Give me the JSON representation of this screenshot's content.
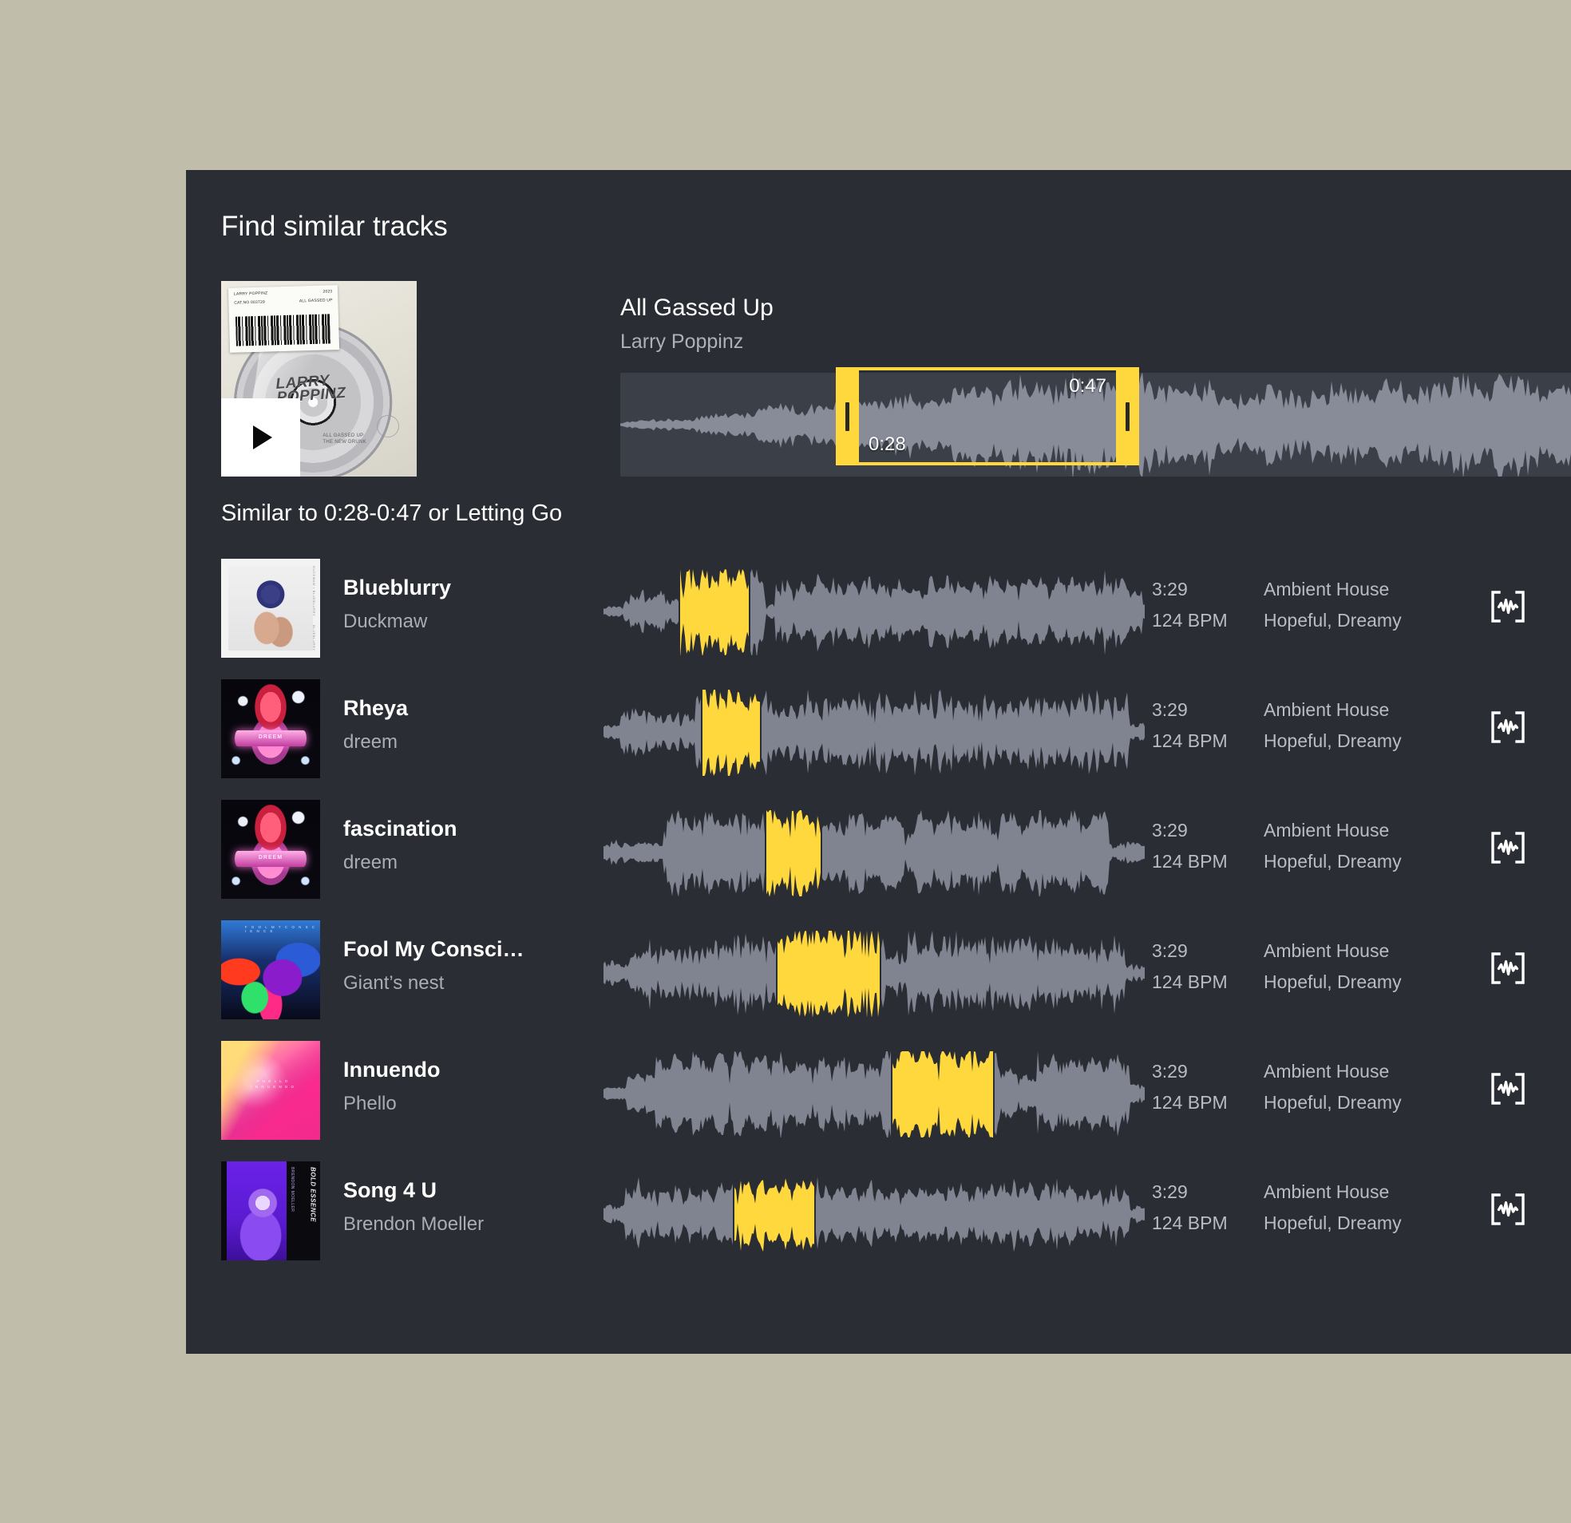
{
  "theme": {
    "page_background": "#c0bdaa",
    "panel_background": "#2a2d33",
    "accent_yellow": "#ffd83d",
    "waveform_gray": "#8e92a0",
    "text_primary": "#ffffff",
    "text_secondary": "#aeb1b8"
  },
  "panel": {
    "title": "Find similar tracks"
  },
  "hero": {
    "title": "All Gassed Up",
    "artist": "Larry Poppinz",
    "play_label": "▶",
    "add_label": "+",
    "artwork": {
      "brand_line1": "LARRY",
      "brand_line2": "POPPINZ",
      "sticker_line1": "LARRY POPPINZ",
      "sticker_line2": "CAT.NO 003729",
      "sticker_line3": "2023",
      "sticker_line4": "ALL GASSED UP",
      "disc_text_line1": "ALL GASSED UP",
      "disc_text_line2": "THE NEW DRUNK"
    },
    "selection": {
      "start_time": "0:28",
      "end_time": "0:47"
    }
  },
  "results": {
    "heading": "Similar to 0:28-0:47 or Letting Go",
    "tracks": [
      {
        "title": "Blueblurry",
        "artist": "Duckmaw",
        "duration": "3:29",
        "bpm": "124 BPM",
        "genre": "Ambient House",
        "mood": "Hopeful, Dreamy",
        "action_icon": "waveform-bracket-icon",
        "art_style": "blueberry-head",
        "highlight_start_pct": 14,
        "highlight_end_pct": 27
      },
      {
        "title": "Rheya",
        "artist": "dreem",
        "duration": "3:29",
        "bpm": "124 BPM",
        "genre": "Ambient House",
        "mood": "Hopeful, Dreamy",
        "action_icon": "waveform-bracket-icon",
        "art_style": "pink-figure",
        "highlight_start_pct": 18,
        "highlight_end_pct": 29
      },
      {
        "title": "fascination",
        "artist": "dreem",
        "duration": "3:29",
        "bpm": "124 BPM",
        "genre": "Ambient House",
        "mood": "Hopeful, Dreamy",
        "action_icon": "waveform-bracket-icon",
        "art_style": "pink-figure",
        "highlight_start_pct": 30,
        "highlight_end_pct": 40
      },
      {
        "title": "Fool My Consci…",
        "artist": "Giant’s nest",
        "duration": "3:29",
        "bpm": "124 BPM",
        "genre": "Ambient House",
        "mood": "Hopeful, Dreamy",
        "action_icon": "waveform-bracket-icon",
        "art_style": "neon-abstract",
        "highlight_start_pct": 32,
        "highlight_end_pct": 51
      },
      {
        "title": "Innuendo",
        "artist": "Phello",
        "duration": "3:29",
        "bpm": "124 BPM",
        "genre": "Ambient House",
        "mood": "Hopeful, Dreamy",
        "action_icon": "waveform-bracket-icon",
        "art_style": "pink-prism",
        "highlight_start_pct": 53,
        "highlight_end_pct": 72
      },
      {
        "title": "Song 4 U",
        "artist": "Brendon Moeller",
        "duration": "3:29",
        "bpm": "124 BPM",
        "genre": "Ambient House",
        "mood": "Hopeful, Dreamy",
        "action_icon": "waveform-bracket-icon",
        "art_style": "purple-portrait",
        "highlight_start_pct": 24,
        "highlight_end_pct": 39
      }
    ]
  }
}
